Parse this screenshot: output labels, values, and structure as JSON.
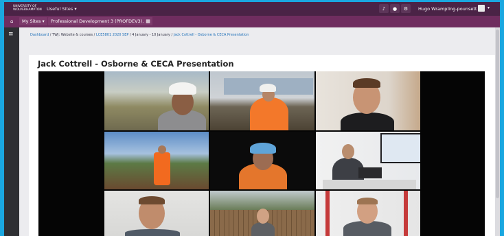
{
  "topbar": {
    "logo_text": "UNIVERSITY OF\nWOLVERHAMPTON",
    "useful_sites": "Useful Sites",
    "user_name": "Hugo Wrampling-pounsett",
    "icons": [
      "bell-icon",
      "chat-icon",
      "gear-icon"
    ]
  },
  "subbar": {
    "my_sites": "My Sites",
    "module": "Professional Development 3 (PROFDEV3)...",
    "icons": [
      "home-icon",
      "grid-icon"
    ]
  },
  "breadcrumb": {
    "items": [
      "Dashboard",
      "TWJ: Website & courses",
      "LCE5801 2020 SEP",
      "4 January - 10 January"
    ],
    "current": "Jack Cottrell - Osborne & CECA Presentation"
  },
  "page": {
    "title": "Jack Cottrell - Osborne & CECA Presentation"
  },
  "video": {
    "layout": "3x3 video call grid"
  },
  "colors": {
    "outer_border": "#1aa7e0",
    "topbar": "#4a2346",
    "subbar": "#6f2d5f",
    "sidebar": "#2e2f33",
    "link": "#1d6fb8"
  }
}
